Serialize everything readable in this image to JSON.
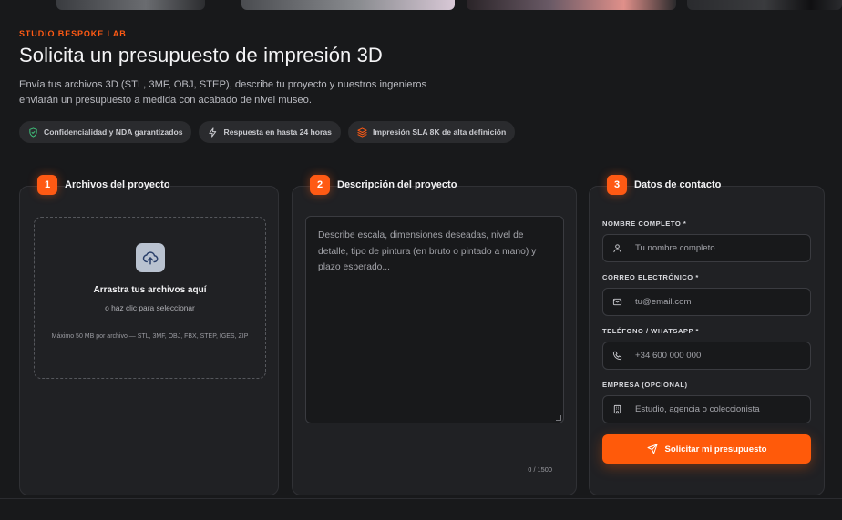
{
  "header": {
    "eyebrow": "STUDIO BESPOKE LAB",
    "title": "Solicita un presupuesto de impresión 3D",
    "intro": "Envía tus archivos 3D (STL, 3MF, OBJ, STEP), describe tu proyecto y nuestros ingenieros enviarán un presupuesto a medida con acabado de nivel museo."
  },
  "badges": [
    {
      "icon": "shield-check-icon",
      "label": "Confidencialidad y NDA garantizados"
    },
    {
      "icon": "lightning-icon",
      "label": "Respuesta en hasta 24 horas"
    },
    {
      "icon": "layers-icon",
      "label": "Impresión SLA 8K de alta definición"
    }
  ],
  "steps": [
    {
      "number": "1",
      "label": "Archivos del proyecto"
    },
    {
      "number": "2",
      "label": "Descripción del proyecto"
    },
    {
      "number": "3",
      "label": "Datos de contacto"
    }
  ],
  "upload": {
    "title": "Arrastra tus archivos aquí",
    "subtitle": "o haz clic para seleccionar",
    "hint": "Máximo 50 MB por archivo — STL, 3MF, OBJ, FBX, STEP, IGES, ZIP"
  },
  "description": {
    "placeholder": "Describe escala, dimensiones deseadas, nivel de detalle, tipo de pintura (en bruto o pintado a mano) y plazo esperado...",
    "counter": "0 / 1500"
  },
  "contact": {
    "fields": [
      {
        "label": "NOMBRE COMPLETO *",
        "placeholder": "Tu nombre completo",
        "icon": "user-icon"
      },
      {
        "label": "CORREO ELECTRÓNICO *",
        "placeholder": "tu@email.com",
        "icon": "mail-icon"
      },
      {
        "label": "TELÉFONO / WHATSAPP *",
        "placeholder": "+34 600 000 000",
        "icon": "phone-icon"
      },
      {
        "label": "EMPRESA (OPCIONAL)",
        "placeholder": "Estudio, agencia o coleccionista",
        "icon": "building-icon"
      }
    ],
    "submit_label": "Solicitar mi presupuesto"
  },
  "colors": {
    "accent": "#ff5a14",
    "background": "#18191b",
    "panel": "#202124"
  }
}
